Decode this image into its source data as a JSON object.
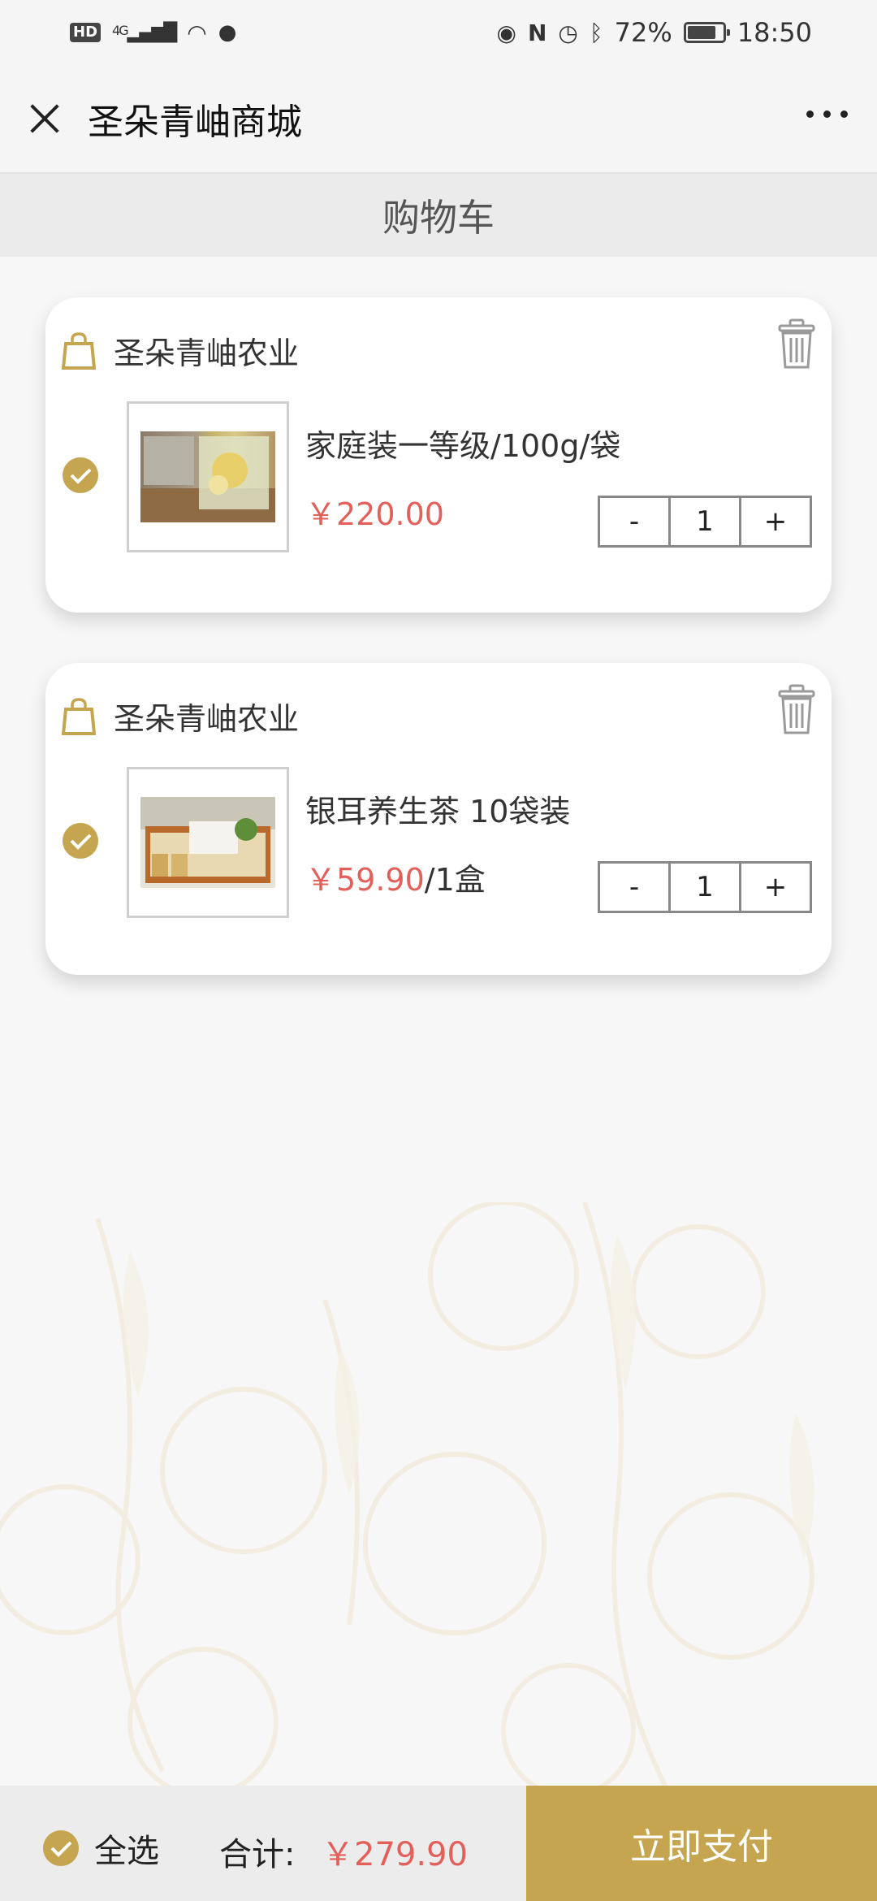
{
  "status_bar": {
    "left_badge": "HD",
    "network": "4G",
    "battery": "72%",
    "time": "18:50"
  },
  "app_bar": {
    "title": "圣朵青岫商城"
  },
  "page": {
    "title": "购物车"
  },
  "cart": {
    "items": [
      {
        "shop_name": "圣朵青岫农业",
        "product_name": "家庭装一等级/100g/袋",
        "price": "￥220.00",
        "unit": "",
        "quantity": "1",
        "checked": true
      },
      {
        "shop_name": "圣朵青岫农业",
        "product_name": "银耳养生茶 10袋装",
        "price": "￥59.90",
        "unit": "/1盒",
        "quantity": "1",
        "checked": true
      }
    ],
    "stepper": {
      "minus": "-",
      "plus": "+"
    }
  },
  "bottom_bar": {
    "select_all_label": "全选",
    "total_label": "合计:",
    "total_value": "￥279.90",
    "pay_label": "立即支付"
  },
  "colors": {
    "accent_gold": "#c5a54f",
    "price_red": "#e3605a"
  }
}
